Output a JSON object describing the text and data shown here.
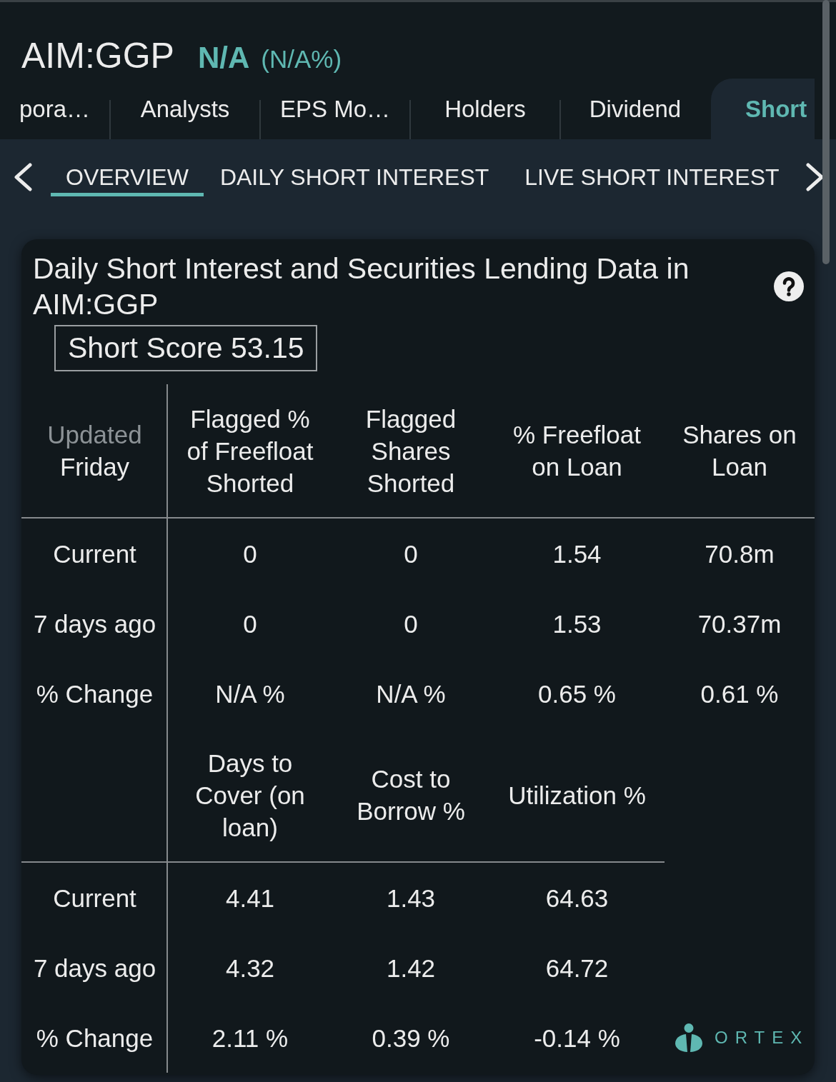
{
  "header": {
    "symbol": "AIM:GGP",
    "change": "N/A",
    "change_percent": "(N/A%)"
  },
  "tabs": [
    {
      "label": "pora…",
      "selected": false
    },
    {
      "label": "Analysts",
      "selected": false
    },
    {
      "label": "EPS Mo…",
      "selected": false
    },
    {
      "label": "Holders",
      "selected": false
    },
    {
      "label": "Dividend",
      "selected": false
    },
    {
      "label": "Short",
      "selected": true
    }
  ],
  "subtabs": [
    {
      "label": "OVERVIEW",
      "selected": true
    },
    {
      "label": "DAILY SHORT INTEREST",
      "selected": false
    },
    {
      "label": "LIVE SHORT INTEREST",
      "selected": false
    }
  ],
  "card": {
    "title": "Daily Short Interest and Securities Lending Data in AIM:GGP",
    "short_score": "Short Score 53.15",
    "tables": [
      {
        "updated": {
          "label": "Updated",
          "day": "Friday"
        },
        "columns": [
          "Flagged % of Freefloat Shorted",
          "Flagged Shares Shorted",
          "% Freefloat on Loan",
          "Shares on Loan"
        ],
        "rows": [
          {
            "label": "Current",
            "cells": [
              "0",
              "0",
              "1.54",
              "70.8m"
            ]
          },
          {
            "label": "7 days ago",
            "cells": [
              "0",
              "0",
              "1.53",
              "70.37m"
            ]
          },
          {
            "label": "% Change",
            "cells": [
              "N/A %",
              "N/A %",
              "0.65 %",
              "0.61 %"
            ]
          }
        ]
      },
      {
        "columns": [
          "Days to Cover (on loan)",
          "Cost to Borrow %",
          "Utilization %"
        ],
        "rows": [
          {
            "label": "Current",
            "cells": [
              "4.41",
              "1.43",
              "64.63"
            ]
          },
          {
            "label": "7 days ago",
            "cells": [
              "4.32",
              "1.42",
              "64.72"
            ]
          },
          {
            "label": "% Change",
            "cells": [
              "2.11 %",
              "0.39 %",
              "-0.14 %"
            ]
          }
        ]
      }
    ],
    "logo": "ORTEX"
  }
}
